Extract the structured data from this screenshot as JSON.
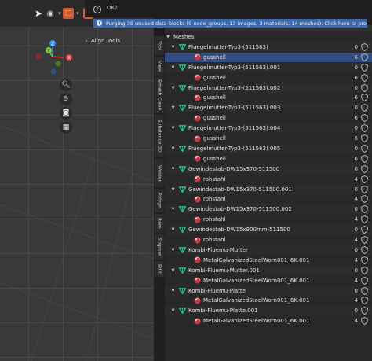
{
  "viewport": {
    "panel_title": "Align Tools",
    "gizmo": {
      "z": "Z",
      "y": "Y",
      "x": "X"
    }
  },
  "sidebar_tabs": [
    "Tool",
    "View",
    "Bmesh Clean",
    "Substance 3D",
    "Welder",
    "Polygn",
    "Item",
    "Stepper",
    "Edit"
  ],
  "popup": {
    "help_symbol": "?",
    "text": "OK?"
  },
  "report": {
    "icon": "i",
    "message": "Purging 39 unused data-blocks (9 node_groups, 13 images, 3 materials, 14 meshes). Click here to proceed..."
  },
  "outliner": {
    "header": "Meshes",
    "rows": [
      {
        "type": "mesh",
        "label": "Fluegelmutter-Typ3-(511563)",
        "users": "0"
      },
      {
        "type": "material",
        "label": "gusshell",
        "users": "6",
        "selected": true
      },
      {
        "type": "mesh",
        "label": "Fluegelmutter-Typ3-(511563).001",
        "users": "0"
      },
      {
        "type": "material",
        "label": "gusshell",
        "users": "6"
      },
      {
        "type": "mesh",
        "label": "Fluegelmutter-Typ3-(511563).002",
        "users": "0"
      },
      {
        "type": "material",
        "label": "gusshell",
        "users": "6"
      },
      {
        "type": "mesh",
        "label": "Fluegelmutter-Typ3-(511563).003",
        "users": "0"
      },
      {
        "type": "material",
        "label": "gusshell",
        "users": "6"
      },
      {
        "type": "mesh",
        "label": "Fluegelmutter-Typ3-(511563).004",
        "users": "0"
      },
      {
        "type": "material",
        "label": "gusshell",
        "users": "6"
      },
      {
        "type": "mesh",
        "label": "Fluegelmutter-Typ3-(511563).005",
        "users": "0"
      },
      {
        "type": "material",
        "label": "gusshell",
        "users": "6"
      },
      {
        "type": "mesh",
        "label": "Gewindestab-DW15x370-511500",
        "users": "0"
      },
      {
        "type": "material",
        "label": "rohstahl",
        "users": "4"
      },
      {
        "type": "mesh",
        "label": "Gewindestab-DW15x370-511500.001",
        "users": "0"
      },
      {
        "type": "material",
        "label": "rohstahl",
        "users": "4"
      },
      {
        "type": "mesh",
        "label": "Gewindestab-DW15x370-511500.002",
        "users": "0"
      },
      {
        "type": "material",
        "label": "rohstahl",
        "users": "4"
      },
      {
        "type": "mesh",
        "label": "Gewindestab-DW15x900mm-511500",
        "users": "0"
      },
      {
        "type": "material",
        "label": "rohstahl",
        "users": "4"
      },
      {
        "type": "mesh",
        "label": "Kombi-Fluemu-Mutter",
        "users": "0"
      },
      {
        "type": "material",
        "label": "MetalGalvanizedSteelWorn001_6K.001",
        "users": "4"
      },
      {
        "type": "mesh",
        "label": "Kombi-Fluemu-Mutter.001",
        "users": "0"
      },
      {
        "type": "material",
        "label": "MetalGalvanizedSteelWorn001_6K.001",
        "users": "4"
      },
      {
        "type": "mesh",
        "label": "Kombi-Fluemu-Platte",
        "users": "0"
      },
      {
        "type": "material",
        "label": "MetalGalvanizedSteelWorn001_6K.001",
        "users": "4"
      },
      {
        "type": "mesh",
        "label": "Kombi-Fluemu-Platte.001",
        "users": "0"
      },
      {
        "type": "material",
        "label": "MetalGalvanizedSteelWorn001_6K.001",
        "users": "4"
      }
    ]
  },
  "colors": {
    "selection": "#334d80",
    "report_bg": "#3f68a8",
    "mesh_icon": "#2fb89a",
    "material_icon": "#c0394a",
    "axis_x": "#e0403f",
    "axis_y": "#7fc73a",
    "axis_z": "#3a8ee6"
  },
  "icons": {
    "topbar": [
      "cursor-icon",
      "visibility-icon",
      "select-box-icon",
      "object-mode-icon"
    ],
    "navigation": [
      "zoom-icon",
      "hand-pan-icon",
      "camera-icon",
      "grid-icon"
    ],
    "row_trailing": "shield-icon"
  }
}
